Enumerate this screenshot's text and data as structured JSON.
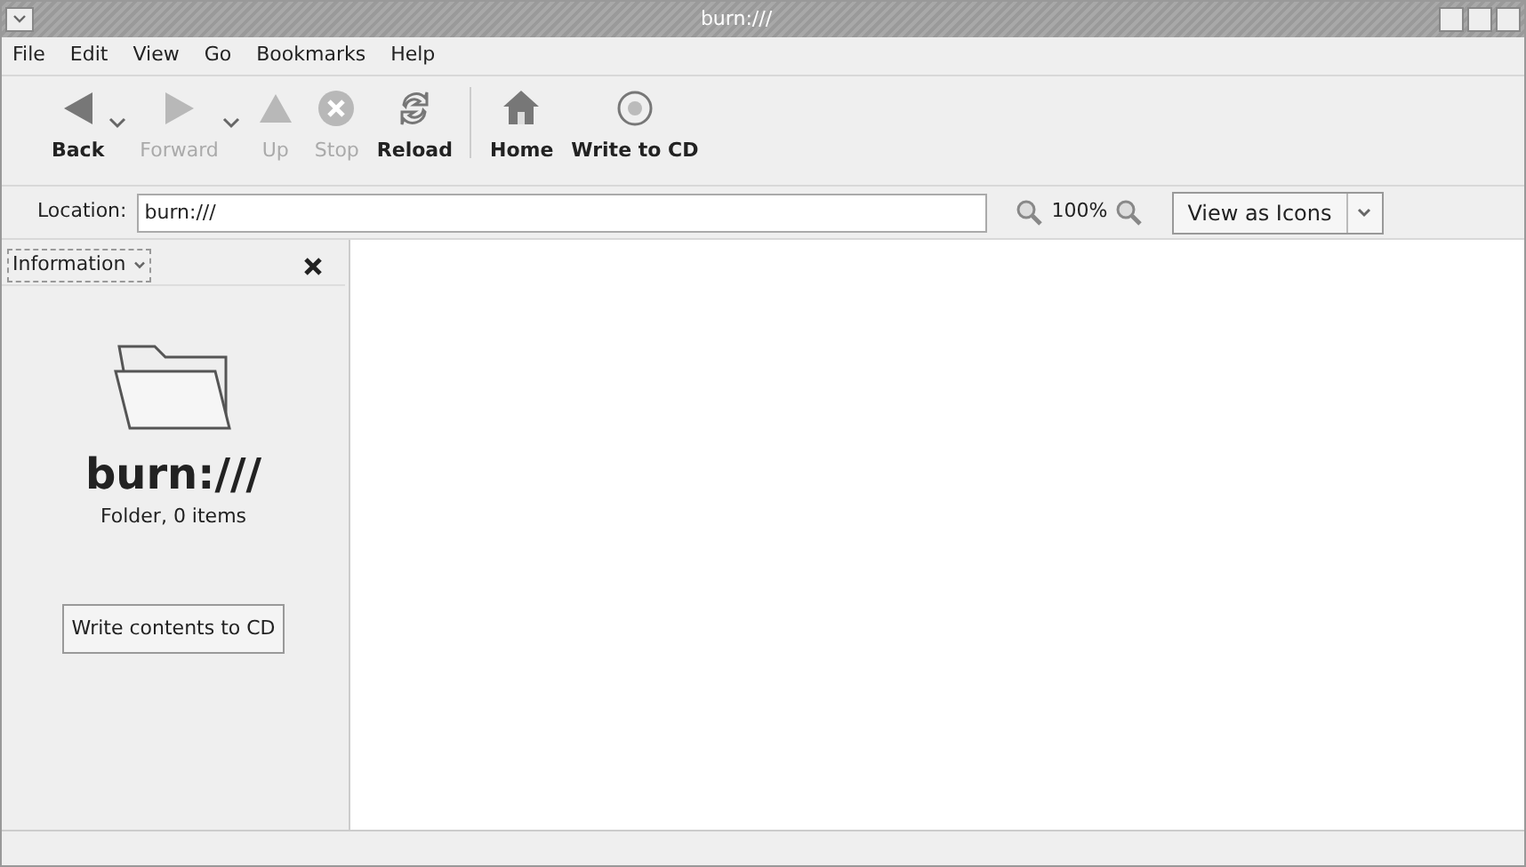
{
  "window": {
    "title": "burn:///"
  },
  "menu": [
    "File",
    "Edit",
    "View",
    "Go",
    "Bookmarks",
    "Help"
  ],
  "toolbar": [
    {
      "kind": "back",
      "label": "Back",
      "disabled": false,
      "has_menu": true
    },
    {
      "kind": "forward",
      "label": "Forward",
      "disabled": true,
      "has_menu": true
    },
    {
      "kind": "up",
      "label": "Up",
      "disabled": true,
      "has_menu": false
    },
    {
      "kind": "stop",
      "label": "Stop",
      "disabled": true,
      "has_menu": false
    },
    {
      "kind": "reload",
      "label": "Reload",
      "disabled": false,
      "has_menu": false
    },
    {
      "kind": "home",
      "label": "Home",
      "disabled": false,
      "has_menu": false
    },
    {
      "kind": "cd",
      "label": "Write to CD",
      "disabled": false,
      "has_menu": false
    }
  ],
  "location": {
    "label": "Location:",
    "value": "burn:///",
    "zoom": "100%",
    "view": "View as Icons"
  },
  "sidebar": {
    "selector": "Information",
    "title": "burn:///",
    "subtitle": "Folder, 0 items",
    "button": "Write contents to CD"
  }
}
